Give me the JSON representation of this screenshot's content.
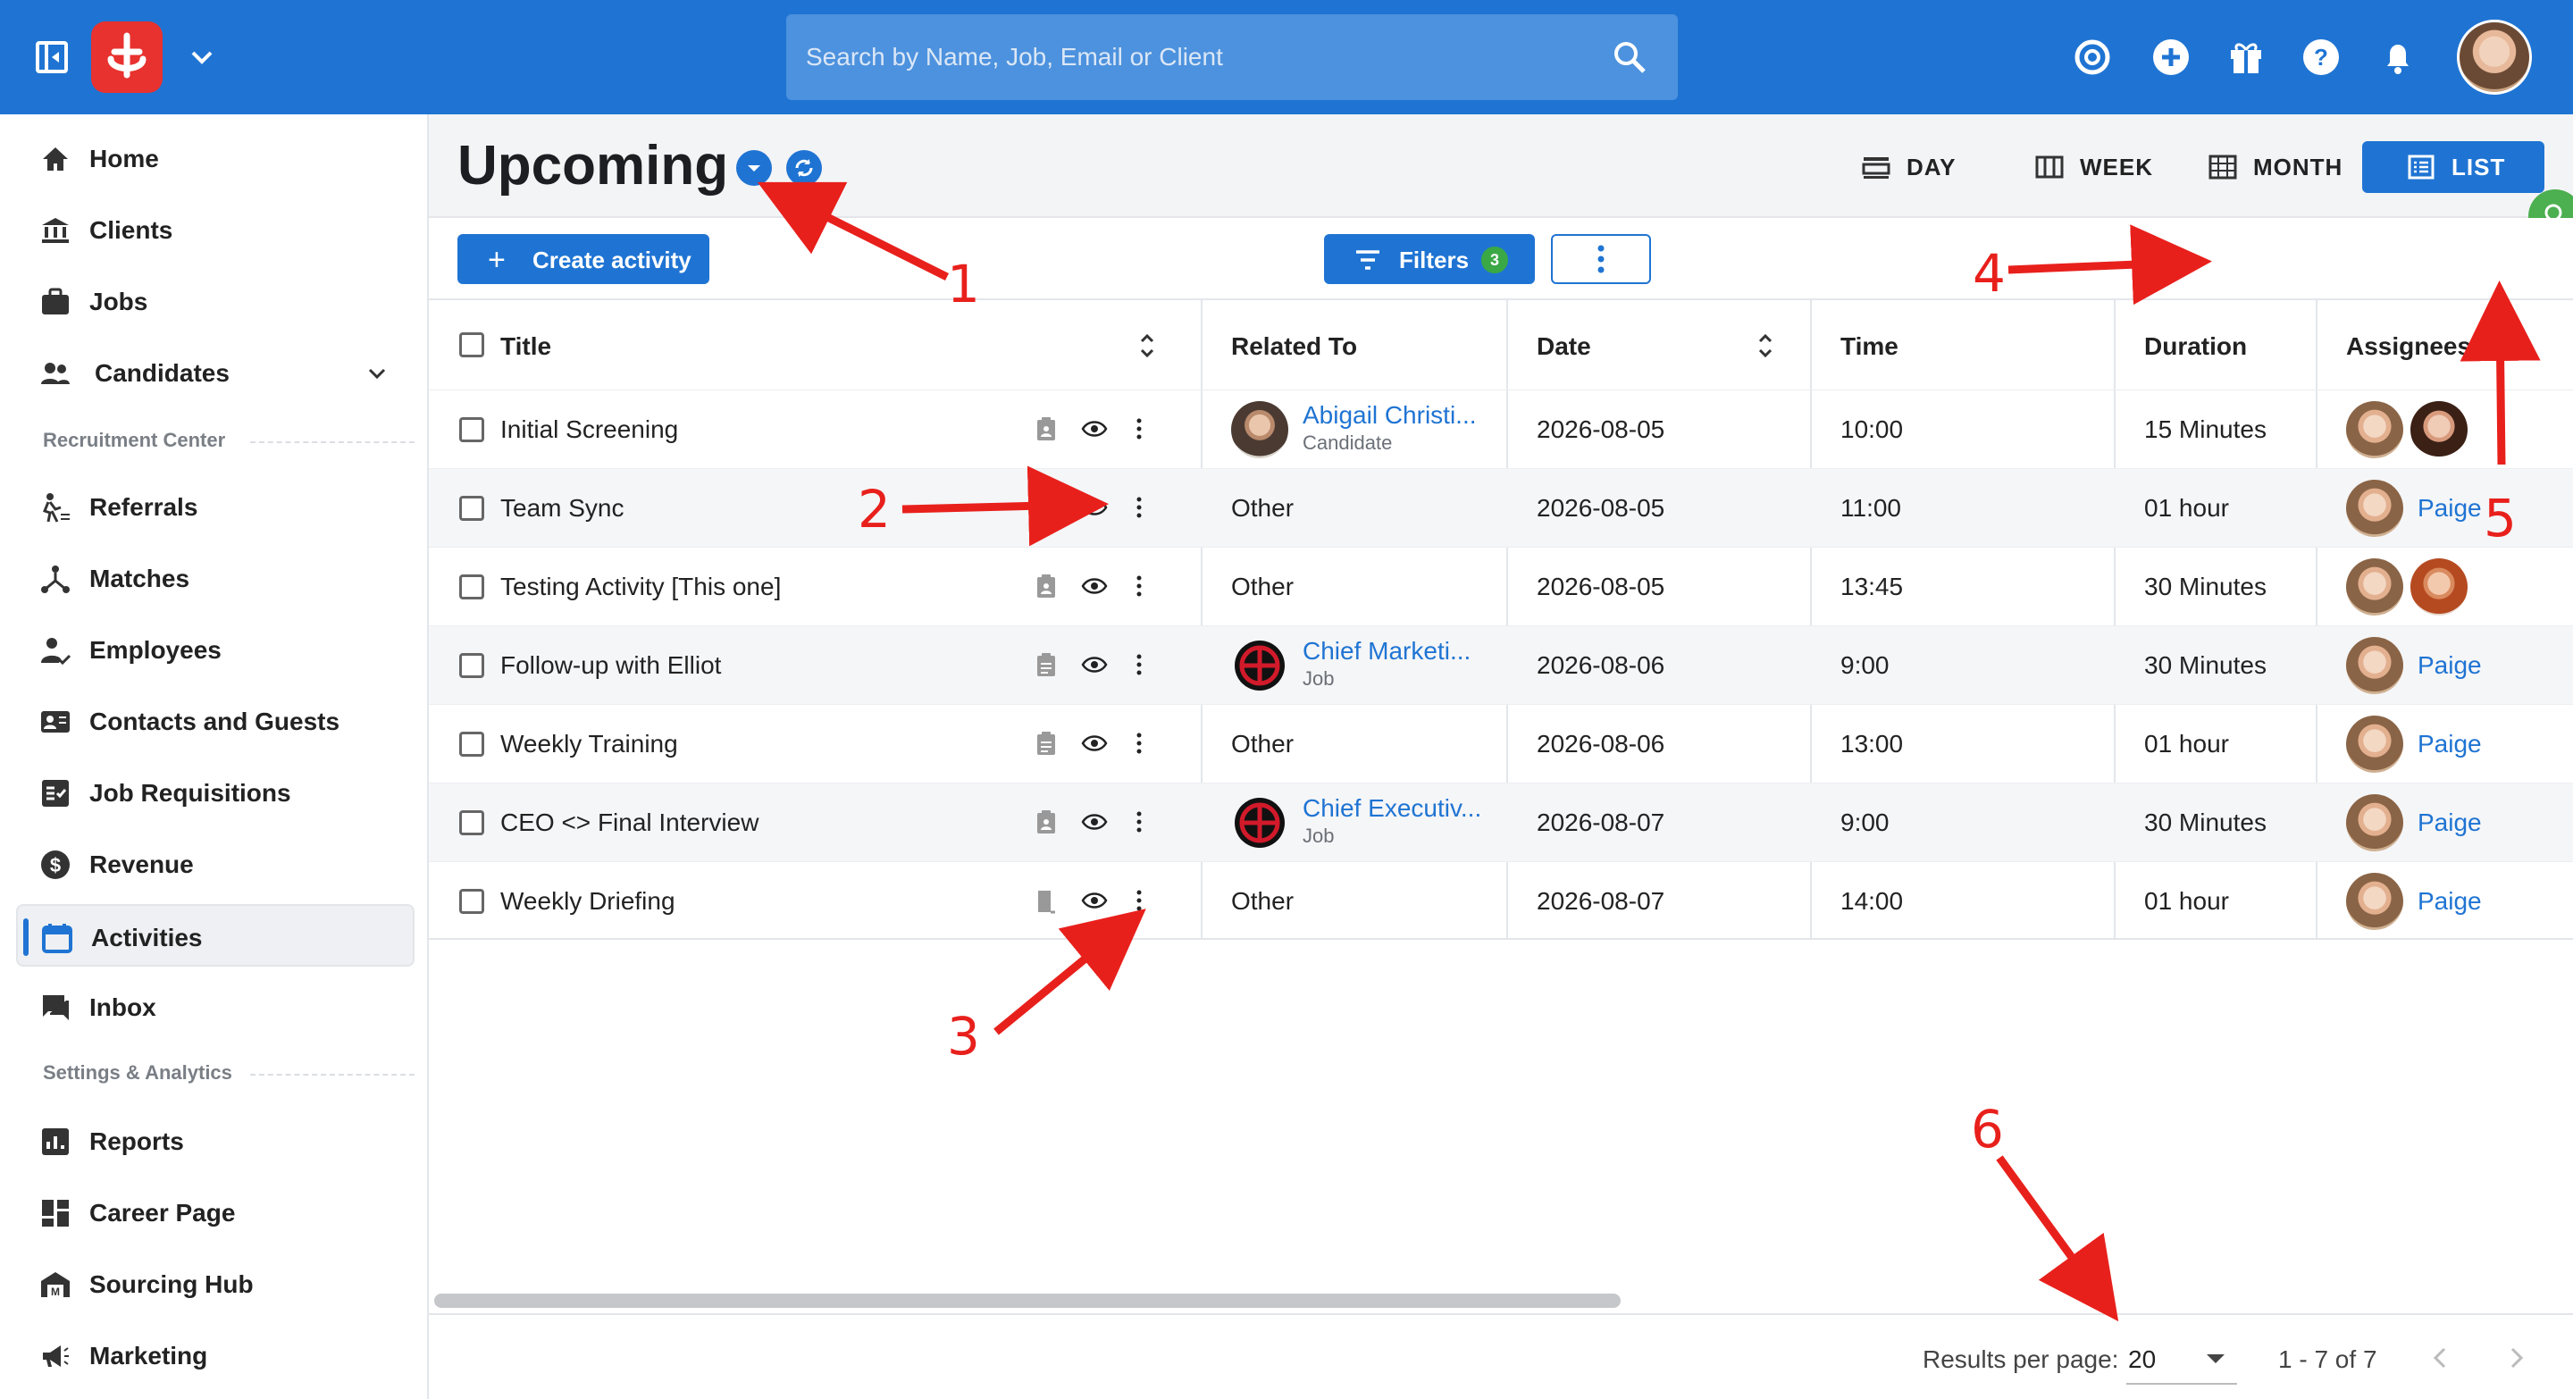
{
  "topbar": {
    "search_placeholder": "Search by Name, Job, Email or Client",
    "brand_color": "#1f74d3",
    "logo_color": "#e8322f"
  },
  "sidebar": {
    "items": [
      {
        "label": "Home",
        "icon": "home-icon"
      },
      {
        "label": "Clients",
        "icon": "bank-icon"
      },
      {
        "label": "Jobs",
        "icon": "briefcase-icon"
      },
      {
        "label": "Candidates",
        "icon": "people-icon"
      },
      {
        "label": "Referrals",
        "icon": "referral-icon"
      },
      {
        "label": "Matches",
        "icon": "matches-icon"
      },
      {
        "label": "Employees",
        "icon": "employee-icon"
      },
      {
        "label": "Contacts and Guests",
        "icon": "contacts-icon"
      },
      {
        "label": "Job Requisitions",
        "icon": "requisition-icon"
      },
      {
        "label": "Revenue",
        "icon": "dollar-icon"
      },
      {
        "label": "Activities",
        "icon": "calendar-icon"
      },
      {
        "label": "Inbox",
        "icon": "inbox-icon"
      },
      {
        "label": "Reports",
        "icon": "chart-icon"
      },
      {
        "label": "Career Page",
        "icon": "dashboard-icon"
      },
      {
        "label": "Sourcing Hub",
        "icon": "warehouse-icon"
      },
      {
        "label": "Marketing",
        "icon": "megaphone-icon"
      }
    ],
    "sections": {
      "recruitment": "Recruitment Center",
      "settings": "Settings & Analytics"
    },
    "active": "Activities"
  },
  "header": {
    "title": "Upcoming",
    "views": {
      "day": "DAY",
      "week": "WEEK",
      "month": "MONTH",
      "list": "LIST"
    },
    "active_view": "LIST"
  },
  "toolbar": {
    "create_label": "Create activity",
    "filters_label": "Filters",
    "filters_count": "3"
  },
  "table": {
    "columns": {
      "title": "Title",
      "related": "Related To",
      "date": "Date",
      "time": "Time",
      "duration": "Duration",
      "assignees": "Assignees"
    },
    "rows": [
      {
        "title": "Initial Screening",
        "related": "Abigail Christi...",
        "related_sub": "Candidate",
        "date": "2026-08-05",
        "time": "10:00",
        "duration": "15 Minutes",
        "assignee": ""
      },
      {
        "title": "Team Sync",
        "related": "Other",
        "related_sub": "",
        "date": "2026-08-05",
        "time": "11:00",
        "duration": "01 hour",
        "assignee": "Paige"
      },
      {
        "title": "Testing Activity [This one]",
        "related": "Other",
        "related_sub": "",
        "date": "2026-08-05",
        "time": "13:45",
        "duration": "30 Minutes",
        "assignee": ""
      },
      {
        "title": "Follow-up with Elliot",
        "related": "Chief Marketi...",
        "related_sub": "Job",
        "date": "2026-08-06",
        "time": "9:00",
        "duration": "30 Minutes",
        "assignee": "Paige"
      },
      {
        "title": "Weekly Training",
        "related": "Other",
        "related_sub": "",
        "date": "2026-08-06",
        "time": "13:00",
        "duration": "01 hour",
        "assignee": "Paige"
      },
      {
        "title": "CEO <> Final Interview",
        "related": "Chief Executiv...",
        "related_sub": "Job",
        "date": "2026-08-07",
        "time": "9:00",
        "duration": "30 Minutes",
        "assignee": "Paige"
      },
      {
        "title": "Weekly Driefing",
        "related": "Other",
        "related_sub": "",
        "date": "2026-08-07",
        "time": "14:00",
        "duration": "01 hour",
        "assignee": "Paige"
      }
    ]
  },
  "footer": {
    "rpp_label": "Results per page:",
    "rpp_value": "20",
    "range": "1 - 7 of 7"
  },
  "annotations": [
    "1",
    "2",
    "3",
    "4",
    "5",
    "6"
  ],
  "annotation_color": "#e8201c"
}
